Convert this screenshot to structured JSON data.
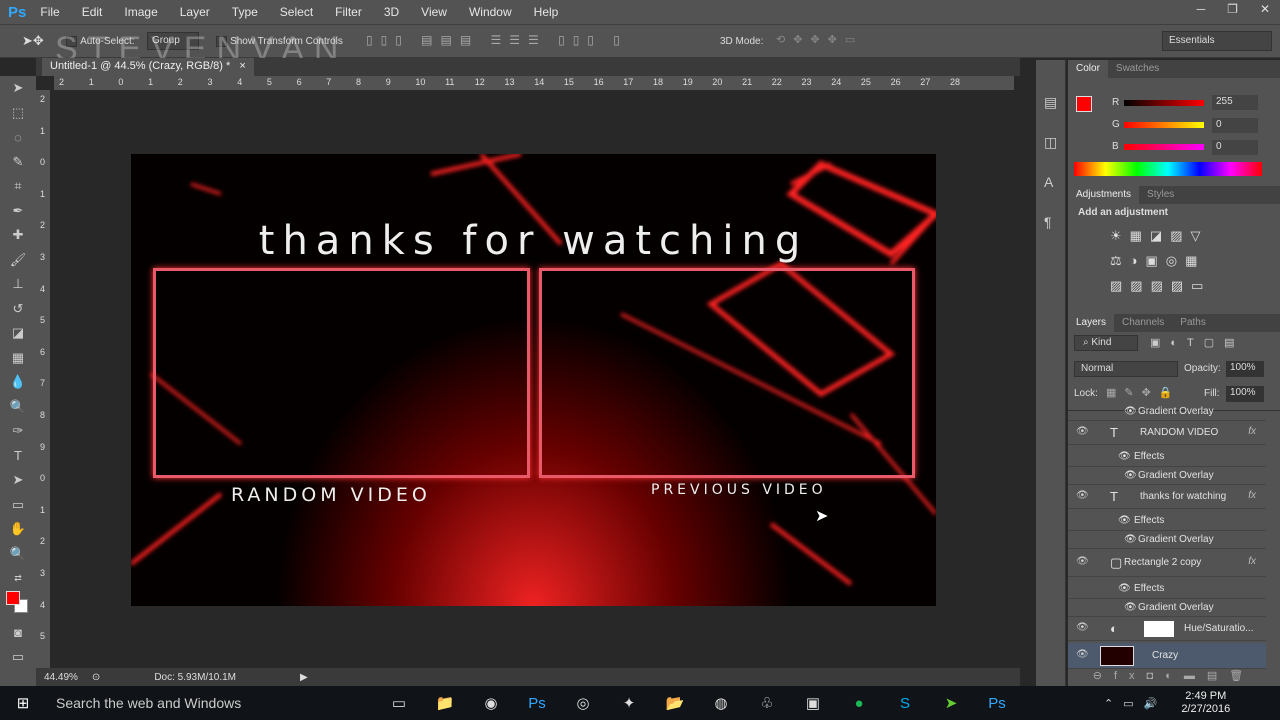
{
  "app": {
    "logo": "Ps",
    "menu": [
      "File",
      "Edit",
      "Image",
      "Layer",
      "Type",
      "Select",
      "Filter",
      "3D",
      "View",
      "Window",
      "Help"
    ],
    "window_controls": [
      "─",
      "❐",
      "✕"
    ]
  },
  "options": {
    "auto_select": "Auto-Select:",
    "group": "Group",
    "show_transform": "Show Transform Controls",
    "mode_3d": "3D Mode:",
    "workspace": "Essentials"
  },
  "watermark": "STEVENVAN",
  "document": {
    "tab_title": "Untitled-1 @ 44.5% (Crazy, RGB/8) *",
    "close": "×",
    "ruler_h": [
      "2",
      "1",
      "0",
      "1",
      "2",
      "3",
      "4",
      "5",
      "6",
      "7",
      "8",
      "9",
      "10",
      "11",
      "12",
      "13",
      "14",
      "15",
      "16",
      "17",
      "18",
      "19",
      "20",
      "21",
      "22",
      "23",
      "24",
      "25",
      "26",
      "27",
      "28"
    ],
    "ruler_v": [
      "2",
      "1",
      "0",
      "1",
      "2",
      "3",
      "4",
      "5",
      "6",
      "7",
      "8",
      "9",
      "0",
      "1",
      "2",
      "3",
      "4",
      "5"
    ]
  },
  "artwork": {
    "headline": "thanks for watching",
    "left_label": "RANDOM VIDEO",
    "right_label": "PREVIOUS VIDEO",
    "accent": "#ff1a1a",
    "frame_color": "#e8596a"
  },
  "status": {
    "zoom": "44.49%",
    "doc": "Doc: 5.93M/10.1M"
  },
  "color_panel": {
    "tabs": [
      "Color",
      "Swatches"
    ],
    "r_label": "R",
    "g_label": "G",
    "b_label": "B",
    "r": "255",
    "g": "0",
    "b": "0",
    "foreground": "#ff0000"
  },
  "adjustments": {
    "tabs": [
      "Adjustments",
      "Styles"
    ],
    "title": "Add an adjustment"
  },
  "layers": {
    "tabs": [
      "Layers",
      "Channels",
      "Paths"
    ],
    "kind": "Kind",
    "blend": "Normal",
    "opacity_label": "Opacity:",
    "opacity": "100%",
    "lock_label": "Lock:",
    "fill_label": "Fill:",
    "fill": "100%",
    "rows": [
      {
        "type": "sub",
        "name": "Gradient Overlay"
      },
      {
        "type": "text",
        "name": "RANDOM VIDEO",
        "fx": "fx"
      },
      {
        "type": "effects",
        "name": "Effects"
      },
      {
        "type": "sub",
        "name": "Gradient Overlay"
      },
      {
        "type": "text",
        "name": "thanks for watching",
        "fx": "fx"
      },
      {
        "type": "effects",
        "name": "Effects"
      },
      {
        "type": "sub",
        "name": "Gradient Overlay"
      },
      {
        "type": "shape",
        "name": "Rectangle 2 copy",
        "fx": "fx"
      },
      {
        "type": "effects",
        "name": "Effects"
      },
      {
        "type": "sub",
        "name": "Gradient Overlay"
      },
      {
        "type": "adj",
        "name": "Hue/Saturatio..."
      },
      {
        "type": "image",
        "name": "Crazy",
        "selected": true
      }
    ]
  },
  "taskbar": {
    "search": "Search the web and Windows",
    "time": "2:49 PM",
    "date": "2/27/2016"
  }
}
